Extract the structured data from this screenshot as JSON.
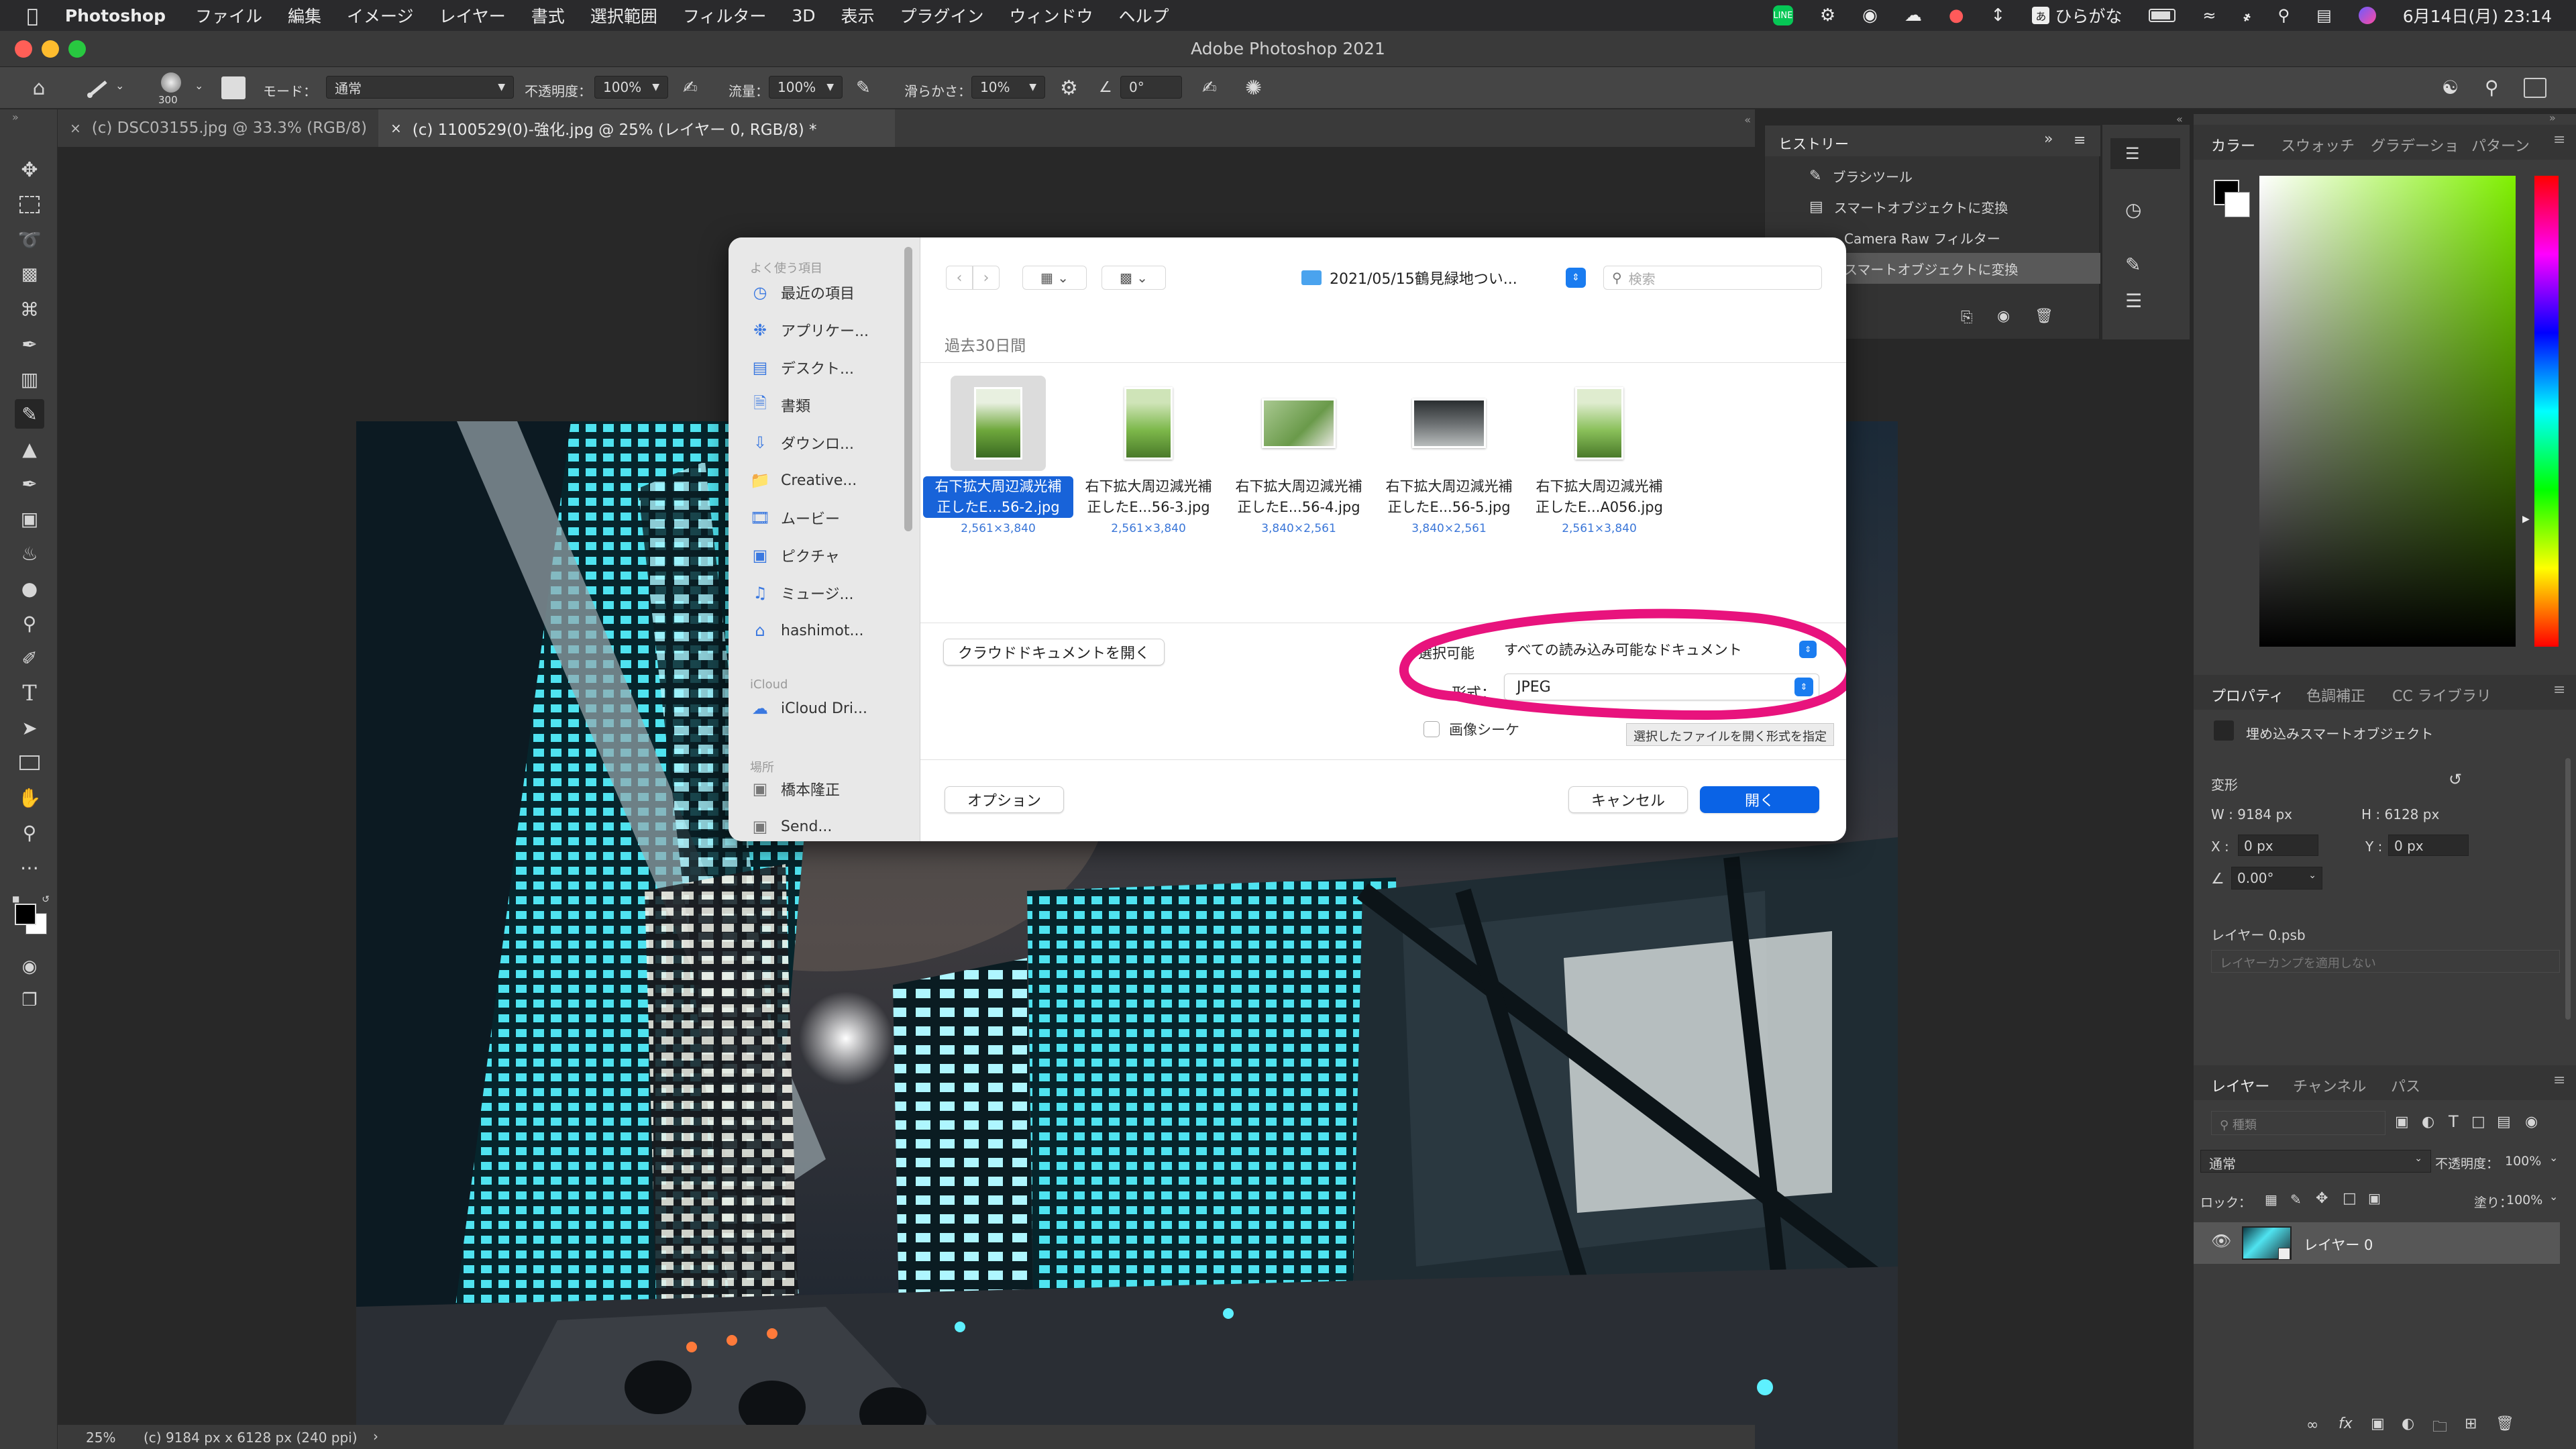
{
  "menubar": {
    "app": "Photoshop",
    "items": [
      "ファイル",
      "編集",
      "イメージ",
      "レイヤー",
      "書式",
      "選択範囲",
      "フィルター",
      "3D",
      "表示",
      "プラグイン",
      "ウィンドウ",
      "ヘルプ"
    ],
    "input_method": "ひらがな",
    "clock": "6月14日(月)  23:14"
  },
  "window": {
    "title": "Adobe Photoshop 2021"
  },
  "options": {
    "brush_size": "300",
    "mode_label": "モード：",
    "mode_value": "通常",
    "opacity_label": "不透明度：",
    "opacity_value": "100%",
    "flow_label": "流量：",
    "flow_value": "100%",
    "smooth_label": "滑らかさ：",
    "smooth_value": "10%",
    "angle_value": "0°"
  },
  "tabs": [
    {
      "label": "(c) DSC03155.jpg @ 33.3% (RGB/8)"
    },
    {
      "label": "(c) 1100529(0)-強化.jpg @ 25% (レイヤー 0, RGB/8) *"
    }
  ],
  "status": {
    "zoom": "25%",
    "info": "(c) 9184 px x 6128 px (240 ppi)"
  },
  "history": {
    "title": "ヒストリー",
    "items": [
      "ブラシツール",
      "スマートオブジェクトに変換",
      "Camera Raw フィルター",
      "スマートオブジェクトに変換"
    ]
  },
  "color_panel": {
    "tabs": [
      "カラー",
      "スウォッチ",
      "グラデーショ",
      "パターン"
    ]
  },
  "properties": {
    "tabs": [
      "プロパティ",
      "色調補正",
      "CC ライブラリ"
    ],
    "type": "埋め込みスマートオブジェクト",
    "transform_label": "変形",
    "w": "W : 9184 px",
    "h": "H : 6128 px",
    "x_label": "X :",
    "x_value": "0 px",
    "y_label": "Y :",
    "y_value": "0 px",
    "angle": "0.00°",
    "file": "レイヤー 0.psb",
    "comp": "レイヤーカンプを適用しない"
  },
  "layers": {
    "tabs": [
      "レイヤー",
      "チャンネル",
      "パス"
    ],
    "search_placeholder": "種類",
    "blend": "通常",
    "opacity_label": "不透明度：",
    "opacity": "100%",
    "lock_label": "ロック：",
    "fill_label": "塗り：",
    "fill": "100%",
    "layer_name": "レイヤー 0"
  },
  "dialog": {
    "sidebar": {
      "favorites_head": "よく使う項目",
      "favorites": [
        "最近の項目",
        "アプリケー...",
        "デスクト...",
        "書類",
        "ダウンロ...",
        "Creative...",
        "ムービー",
        "ピクチャ",
        "ミュージ...",
        "hashimot..."
      ],
      "icloud_head": "iCloud",
      "icloud": [
        "iCloud Dri..."
      ],
      "places_head": "場所",
      "places": [
        "橋本隆正",
        "Send..."
      ]
    },
    "folder": "2021/05/15鶴見緑地つい...",
    "search_placeholder": "検索",
    "section": "過去30日間",
    "files": [
      {
        "name1": "右下拡大周辺減光補",
        "name2": "正したE...56-2.jpg",
        "dims": "2,561×3,840"
      },
      {
        "name1": "右下拡大周辺減光補",
        "name2": "正したE...56-3.jpg",
        "dims": "2,561×3,840"
      },
      {
        "name1": "右下拡大周辺減光補",
        "name2": "正したE...56-4.jpg",
        "dims": "3,840×2,561"
      },
      {
        "name1": "右下拡大周辺減光補",
        "name2": "正したE...56-5.jpg",
        "dims": "3,840×2,561"
      },
      {
        "name1": "右下拡大周辺減光補",
        "name2": "正したE...A056.jpg",
        "dims": "2,561×3,840"
      }
    ],
    "cloud_button": "クラウドドキュメントを開く",
    "enable_label": "選択可能",
    "enable_value": "すべての読み込み可能なドキュメント",
    "format_label": "形式：",
    "format_value": "JPEG",
    "image_seq_label": "画像シーケ",
    "tooltip": "選択したファイルを開く形式を指定",
    "options_button": "オプション",
    "cancel_button": "キャンセル",
    "open_button": "開く"
  },
  "colors": {
    "accent": "#0a63e6",
    "highlight_circle": "#e8137d",
    "selected_file": "#1863d9"
  }
}
